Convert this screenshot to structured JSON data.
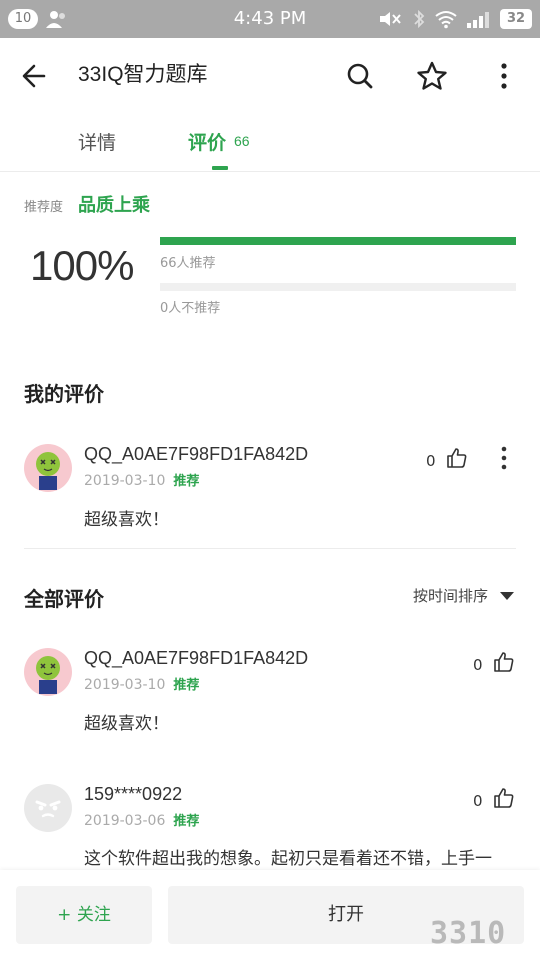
{
  "status_bar": {
    "notification_count": "10",
    "time": "4:43 PM",
    "battery": "32"
  },
  "app_bar": {
    "title": "33IQ智力题库"
  },
  "tabs": [
    {
      "label": "详情"
    },
    {
      "label": "评价",
      "count": "66"
    }
  ],
  "rating": {
    "label": "推荐度",
    "quality": "品质上乘",
    "percent": "100%",
    "recommend_text": "66人推荐",
    "recommend_fraction": 1.0,
    "not_recommend_text": "0人不推荐",
    "not_recommend_fraction": 0.0
  },
  "my_review_section": {
    "title": "我的评价",
    "review": {
      "name": "QQ_A0AE7F98FD1FA842D",
      "date": "2019-03-10",
      "tag": "推荐",
      "text": "超级喜欢！",
      "likes": "0"
    }
  },
  "all_reviews_section": {
    "title": "全部评价",
    "sort_label": "按时间排序",
    "reviews": [
      {
        "name": "QQ_A0AE7F98FD1FA842D",
        "date": "2019-03-10",
        "tag": "推荐",
        "text": "超级喜欢！",
        "likes": "0"
      },
      {
        "name": "159****0922",
        "date": "2019-03-06",
        "tag": "推荐",
        "text": "这个软件超出我的想象。起初只是看着还不错，上手一",
        "likes": "0"
      }
    ]
  },
  "bottom_bar": {
    "follow_label": "+ 关注",
    "open_label": "打开"
  },
  "watermark": "3310",
  "colors": {
    "accent": "#2ea44f",
    "status_bar": "#a9a9a9"
  },
  "icons": [
    "back-arrow-icon",
    "search-icon",
    "star-icon",
    "more-vert-icon",
    "thumbs-up-icon",
    "sort-dropdown-icon"
  ]
}
